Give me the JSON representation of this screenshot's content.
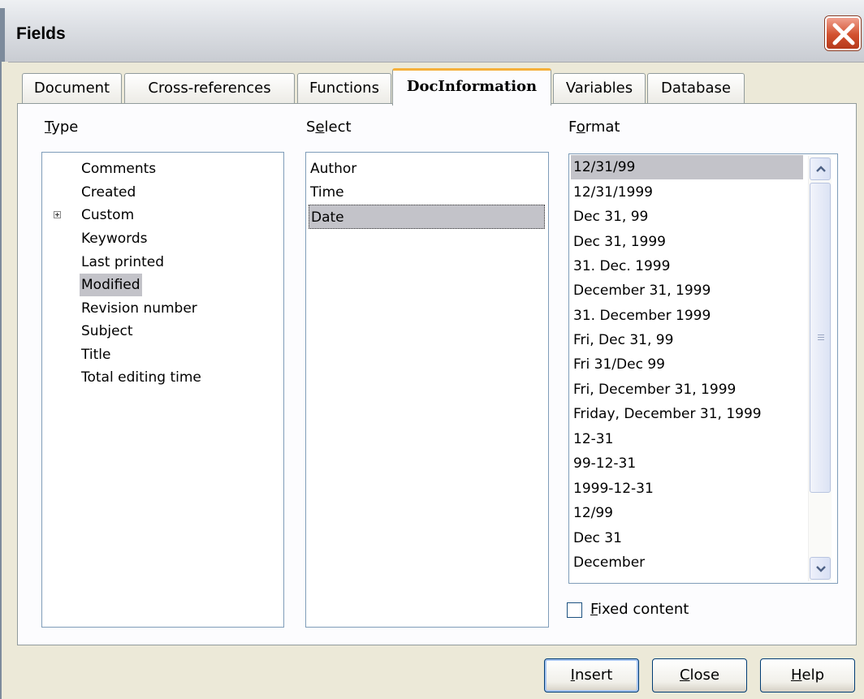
{
  "window": {
    "title": "Fields"
  },
  "tabs": [
    {
      "label": "Document"
    },
    {
      "label": "Cross-references"
    },
    {
      "label": "Functions"
    },
    {
      "label": "DocInformation",
      "active": true
    },
    {
      "label": "Variables"
    },
    {
      "label": "Database"
    }
  ],
  "type": {
    "label_first": "T",
    "label_rest": "ype",
    "items": [
      "Comments",
      "Created",
      "Custom",
      "Keywords",
      "Last printed",
      "Modified",
      "Revision number",
      "Subject",
      "Title",
      "Total editing time"
    ],
    "selected": "Modified",
    "expandable": "Custom"
  },
  "select": {
    "label_first": "S",
    "label_u": "e",
    "label_rest": "lect",
    "items": [
      "Author",
      "Time",
      "Date"
    ],
    "selected": "Date"
  },
  "format": {
    "label_first": "F",
    "label_u": "o",
    "label_rest": "rmat",
    "items": [
      "12/31/99",
      "12/31/1999",
      "Dec 31, 99",
      "Dec 31, 1999",
      "31. Dec. 1999",
      "December 31, 1999",
      "31. December 1999",
      "Fri, Dec 31, 99",
      "Fri 31/Dec 99",
      "Fri, December 31, 1999",
      "Friday, December 31, 1999",
      "12-31",
      "99-12-31",
      "1999-12-31",
      "12/99",
      "Dec 31",
      "December"
    ],
    "selected": "12/31/99"
  },
  "fixed_content": {
    "label_u": "F",
    "label_rest": "ixed content",
    "checked": false
  },
  "buttons": {
    "insert": {
      "u": "I",
      "rest": "nsert"
    },
    "close": {
      "u": "C",
      "rest": "lose"
    },
    "help": {
      "u": "H",
      "rest": "elp"
    }
  },
  "colors": {
    "accent_tab": "#f5b03a",
    "selection": "#c3c3c9",
    "close_button": "#d2512f"
  }
}
